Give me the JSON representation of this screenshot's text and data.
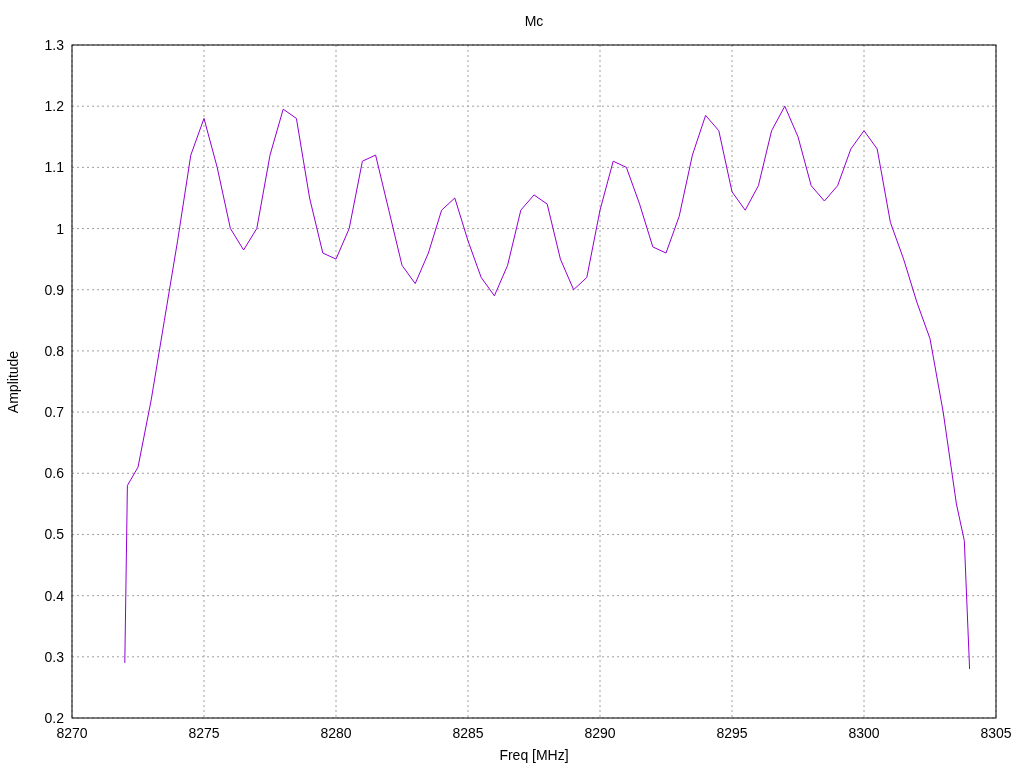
{
  "chart_data": {
    "type": "line",
    "title": "Mc",
    "xlabel": "Freq [MHz]",
    "ylabel": "Amplitude",
    "xlim": [
      8270,
      8305
    ],
    "ylim": [
      0.2,
      1.3
    ],
    "grid": true,
    "xticks": [
      8270,
      8275,
      8280,
      8285,
      8290,
      8295,
      8300,
      8305
    ],
    "yticks": [
      0.2,
      0.3,
      0.4,
      0.5,
      0.6,
      0.7,
      0.8,
      0.9,
      1,
      1.1,
      1.2,
      1.3
    ],
    "x": [
      8272.0,
      8272.1,
      8272.5,
      8273,
      8273.5,
      8274,
      8274.5,
      8275,
      8275.5,
      8276,
      8276.5,
      8277,
      8277.5,
      8278,
      8278.5,
      8279,
      8279.5,
      8280,
      8280.5,
      8281,
      8281.5,
      8282,
      8282.5,
      8283,
      8283.5,
      8284,
      8284.5,
      8285,
      8285.5,
      8286,
      8286.5,
      8287,
      8287.5,
      8288,
      8288.5,
      8289,
      8289.5,
      8290,
      8290.5,
      8291,
      8291.5,
      8292,
      8292.5,
      8293,
      8293.5,
      8294,
      8294.5,
      8295,
      8295.5,
      8296,
      8296.5,
      8297,
      8297.5,
      8298,
      8298.5,
      8299,
      8299.5,
      8300,
      8300.5,
      8301,
      8301.5,
      8302,
      8302.5,
      8303,
      8303.5,
      8303.8,
      8304
    ],
    "series": [
      {
        "color": "#9400d3",
        "values": [
          0.29,
          0.58,
          0.61,
          0.72,
          0.85,
          0.98,
          1.12,
          1.18,
          1.1,
          1.0,
          0.965,
          1.0,
          1.12,
          1.195,
          1.18,
          1.05,
          0.96,
          0.95,
          1.0,
          1.11,
          1.12,
          1.03,
          0.94,
          0.91,
          0.96,
          1.03,
          1.05,
          0.98,
          0.92,
          0.89,
          0.94,
          1.03,
          1.055,
          1.04,
          0.95,
          0.9,
          0.92,
          1.03,
          1.11,
          1.1,
          1.04,
          0.97,
          0.96,
          1.02,
          1.12,
          1.185,
          1.16,
          1.06,
          1.03,
          1.07,
          1.16,
          1.2,
          1.15,
          1.07,
          1.045,
          1.07,
          1.13,
          1.16,
          1.13,
          1.01,
          0.95,
          0.88,
          0.82,
          0.7,
          0.55,
          0.49,
          0.28
        ]
      }
    ]
  }
}
